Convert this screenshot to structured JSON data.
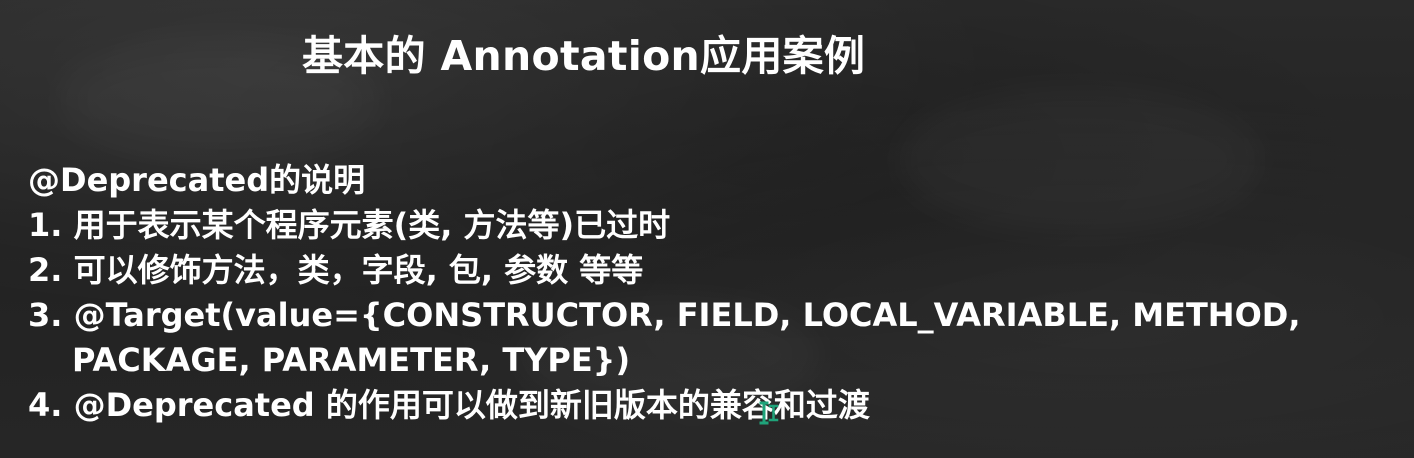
{
  "slide": {
    "title": "基本的 Annotation应用案例",
    "heading": "@Deprecated的说明",
    "points": [
      "1. 用于表示某个程序元素(类, 方法等)已过时",
      "2. 可以修饰方法，类，字段, 包, 参数  等等",
      "3. @Target(value={CONSTRUCTOR, FIELD, LOCAL_VARIABLE, METHOD,",
      "PACKAGE, PARAMETER, TYPE})",
      "4. @Deprecated 的作用可以做到新旧版本的兼容和过渡"
    ]
  },
  "colors": {
    "background": "#242424",
    "text": "#ffffff",
    "cursor": "#1fa37a"
  },
  "icons": {
    "cursor": "text-cursor-icon"
  }
}
